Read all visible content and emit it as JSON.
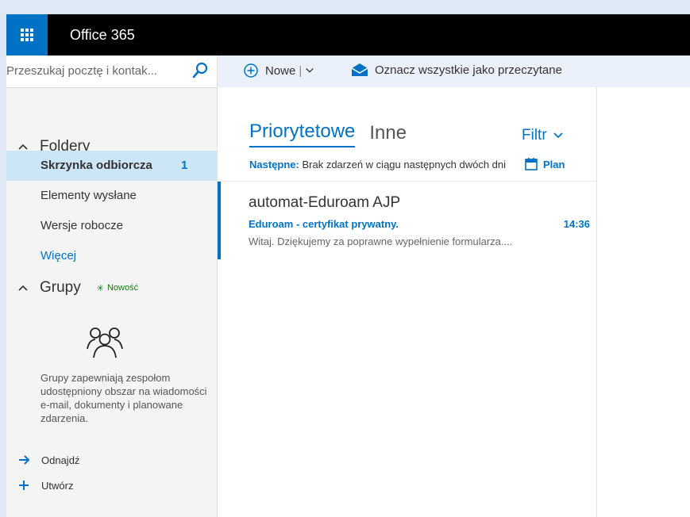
{
  "app": {
    "title": "Office 365"
  },
  "search": {
    "placeholder": "Przeszukaj pocztę i kontak..."
  },
  "commands": {
    "new_label": "Nowe",
    "separator": "|",
    "mark_all_read": "Oznacz wszystkie jako przeczytane"
  },
  "folders": {
    "header": "Foldery",
    "items": [
      {
        "label": "Skrzynka odbiorcza",
        "count": "1",
        "selected": true
      },
      {
        "label": "Elementy wysłane"
      },
      {
        "label": "Wersje robocze"
      }
    ],
    "more": "Więcej"
  },
  "groups": {
    "header": "Grupy",
    "new_badge": "Nowość",
    "description": "Grupy zapewniają zespołom udostępniony obszar na wiadomości e-mail, dokumenty i planowane zdarzenia.",
    "actions": [
      {
        "label": "Odnajdź"
      },
      {
        "label": "Utwórz"
      }
    ]
  },
  "list": {
    "tabs": [
      {
        "label": "Priorytetowe",
        "active": true
      },
      {
        "label": "Inne",
        "active": false
      }
    ],
    "filter": "Filtr",
    "agenda": {
      "prefix": "Następne:",
      "text": "Brak zdarzeń w ciągu następnych dwóch dni",
      "plan_label": "Plan"
    },
    "messages": [
      {
        "sender": "automat-Eduroam AJP",
        "subject": "Eduroam - certyfikat prywatny.",
        "time": "14:36",
        "preview": "Witaj. Dziękujemy za poprawne wypełnienie formularza...."
      }
    ]
  },
  "colors": {
    "accent": "#0072c6",
    "topbar": "#000000",
    "selected": "#cde6f7",
    "new_badge": "#107c10"
  }
}
